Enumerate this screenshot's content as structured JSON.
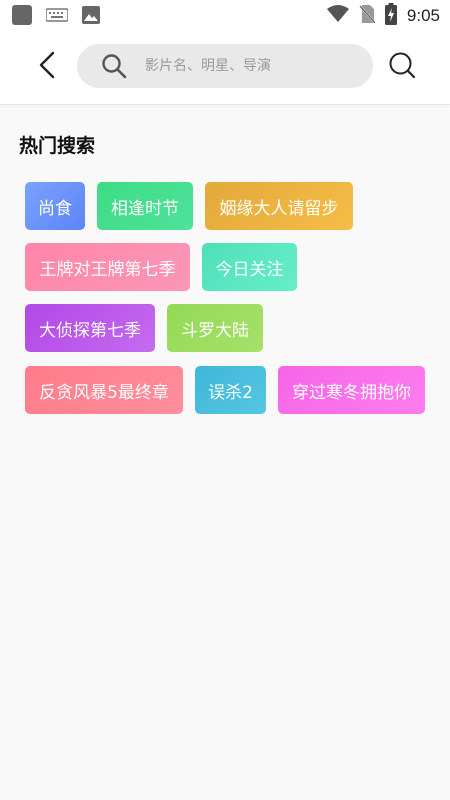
{
  "status_bar": {
    "time": "9:05",
    "icons": [
      "app-square-icon",
      "keyboard-icon",
      "image-icon",
      "wifi-icon",
      "no-sim-icon",
      "battery-charging-icon"
    ]
  },
  "header": {
    "back_icon": "chevron-left-icon",
    "search_placeholder": "影片名、明星、导演",
    "search_value": "",
    "search_icon": "search-icon"
  },
  "hot_search": {
    "title": "热门搜索",
    "tags": [
      {
        "label": "尚食",
        "color_from": "#7aa2ff",
        "color_to": "#5c85f6"
      },
      {
        "label": "相逢时节",
        "color_from": "#3ddc86",
        "color_to": "#4ee29a"
      },
      {
        "label": "姻缘大人请留步",
        "color_from": "#e2a93c",
        "color_to": "#f6be45"
      },
      {
        "label": "王牌对王牌第七季",
        "color_from": "#ff85a8",
        "color_to": "#fb97b7"
      },
      {
        "label": "今日关注",
        "color_from": "#4fe0b9",
        "color_to": "#66eec9"
      },
      {
        "label": "大侦探第七季",
        "color_from": "#b248e6",
        "color_to": "#c56bf0"
      },
      {
        "label": "斗罗大陆",
        "color_from": "#93da55",
        "color_to": "#a6e06a"
      },
      {
        "label": "反贪风暴5最终章",
        "color_from": "#ff7b8a",
        "color_to": "#ff8f9b"
      },
      {
        "label": "误杀2",
        "color_from": "#3fb7d8",
        "color_to": "#55c6e3"
      },
      {
        "label": "穿过寒冬拥抱你",
        "color_from": "#f565e8",
        "color_to": "#ff7dee"
      }
    ]
  }
}
